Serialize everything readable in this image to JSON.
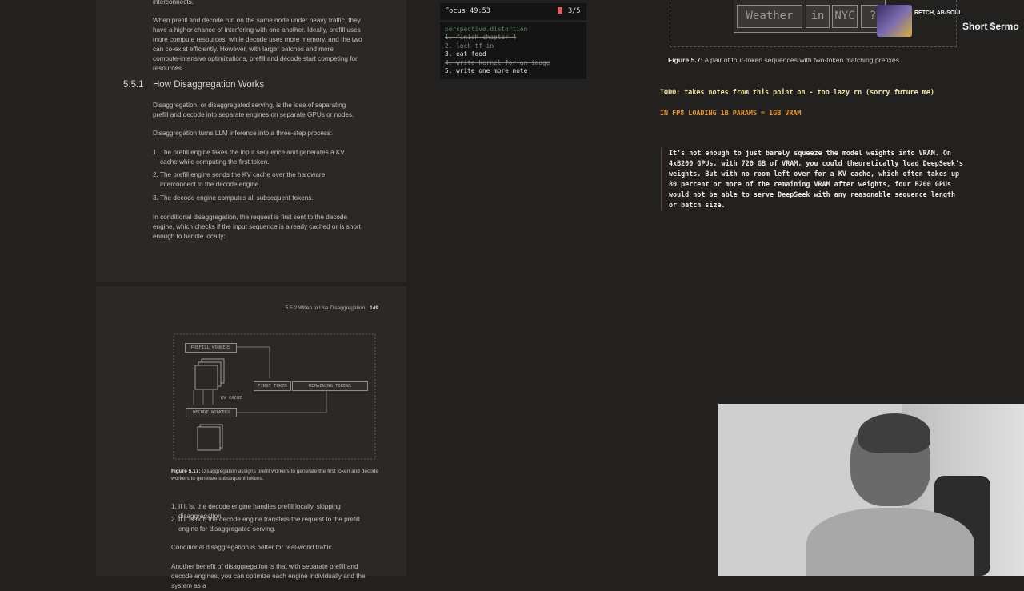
{
  "book": {
    "page1": {
      "top_fragment": "interconnects.",
      "para1": "When prefill and decode run on the same node under heavy traffic, they have a higher chance of interfering with one another. Ideally, prefill uses more compute resources, while decode uses more memory, and the two can co-exist efficiently. However, with larger batches and more compute-intensive optimizations, prefill and decode start competing for resources.",
      "section_number": "5.5.1",
      "section_title": "How Disaggregation Works",
      "para2": "Disaggregation, or disaggregated serving, is the idea of separating prefill and decode into separate engines on separate GPUs or nodes.",
      "para3": "Disaggregation turns LLM inference into a three-step process:",
      "steps": [
        {
          "n": "1.",
          "text": "The prefill engine takes the input sequence and generates a KV cache while computing the first token."
        },
        {
          "n": "2.",
          "text": "The prefill engine sends the KV cache over the hardware interconnect to the decode engine."
        },
        {
          "n": "3.",
          "text": "The decode engine computes all subsequent tokens."
        }
      ],
      "para4": "In conditional disaggregation, the request is first sent to the decode engine, which checks if the input sequence is already cached or is short enough to handle locally:"
    },
    "page2": {
      "running_head": "5.5.2   When to Use Disaggregation",
      "page_number": "149",
      "diagram": {
        "prefill_workers": "PREFILL WORKERS",
        "first_token": "FIRST TOKEN",
        "remaining_tokens": "REMAINING TOKENS",
        "kv_cache": "KV CACHE",
        "decode_workers": "DECODE WORKERS"
      },
      "caption_label": "Figure 5.17:",
      "caption_text": " Disaggregation assigns prefill workers to generate the first token and decode workers to generate subsequent tokens.",
      "cond_steps": [
        {
          "n": "1.",
          "text": "If it is, the decode engine handles prefill locally, skipping disaggregation."
        },
        {
          "n": "2.",
          "text": "If it is not, the decode engine transfers the request to the prefill engine for disaggregated serving."
        }
      ],
      "para5": "Conditional disaggregation is better for real-world traffic.",
      "para6": "Another benefit of disaggregation is that with separate prefill and decode engines, you can optimize each engine individually and the system as a"
    }
  },
  "focus": {
    "label": "Focus 49:53",
    "count": "3/5",
    "list_title": "perspective.distortion",
    "items": [
      {
        "text": "1. finish chapter 4",
        "done": true
      },
      {
        "text": "2. lock tf in",
        "done": true
      },
      {
        "text": "3. eat food",
        "done": false
      },
      {
        "text": "4. write kernel for an image",
        "done": true
      },
      {
        "text": "5. write one more note",
        "done": false
      }
    ]
  },
  "notes": {
    "figure_tokens": [
      "Weather",
      "in",
      "NYC",
      "?"
    ],
    "figure_caption_label": "Figure 5.7:",
    "figure_caption_text": " A pair of four-token sequences with two-token matching prefixes.",
    "todo": "TODO: takes notes from this point on - too lazy rn (sorry future me)",
    "fp8": "IN FP8 LOADING 1B PARAMS = 1GB VRAM",
    "quote": "It's not enough to just barely squeeze the model weights into VRAM. On 4xB200 GPUs, with 720 GB of VRAM, you could theoretically load DeepSeek's weights. But with no room left over for a KV cache, which often takes up 80 percent or more of the remaining VRAM after weights, four B200 GPUs would not be able to serve DeepSeek with any reasonable sequence length or batch size."
  },
  "music": {
    "artist": "RETCH, AB-SOUL",
    "title": "Short $ermo"
  },
  "colors": {
    "accent_orange": "#e5953a",
    "todo_yellow": "#f2e3a4",
    "list_title_green": "#4d8a5e"
  }
}
